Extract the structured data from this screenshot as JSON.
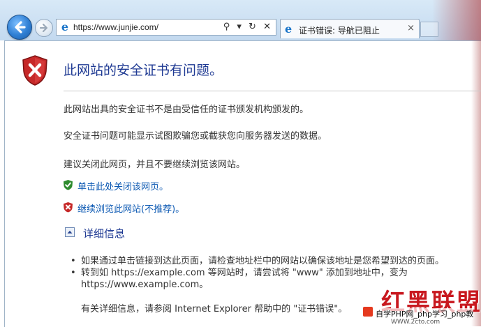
{
  "browser": {
    "url": "https://www.junjie.com/",
    "tab_title": "证书错误: 导航已阻止",
    "tab_close": "×",
    "addr_tools": [
      "⚲",
      "▾",
      "↻",
      "✕"
    ]
  },
  "page": {
    "title": "此网站的安全证书有问题。",
    "paragraphs": [
      "此网站出具的安全证书不是由受信任的证书颁发机构颁发的。",
      "安全证书问题可能显示试图欺骗您或截获您向服务器发送的数据。",
      "建议关闭此网页，并且不要继续浏览该网站。"
    ],
    "close_link": "单击此处关闭该网页。",
    "continue_link": "继续浏览此网站(不推荐)。",
    "more_info_label": "详细信息",
    "bullets": [
      "如果通过单击链接到达此页面，请检查地址栏中的网站以确保该地址是您希望到达的页面。",
      "转到如 https://example.com 等网站时，请尝试将 \"www\" 添加到地址中，变为",
      "https://www.example.com。"
    ],
    "help_text": "有关详细信息，请参阅 Internet Explorer 帮助中的 \"证书错误\"。"
  },
  "watermark": {
    "big": "红黑联盟",
    "small": "自学PHP网_php学习_php教",
    "footer": "WWW.2cto.com"
  },
  "colors": {
    "title": "#1f3a93",
    "link": "#0c59b3",
    "error_shield": "#c62828",
    "safe_shield": "#2e8b2e"
  },
  "icons": {
    "back": "arrow-left",
    "forward": "arrow-right",
    "site": "ie-logo",
    "error": "shield-x",
    "safe": "shield-check"
  }
}
